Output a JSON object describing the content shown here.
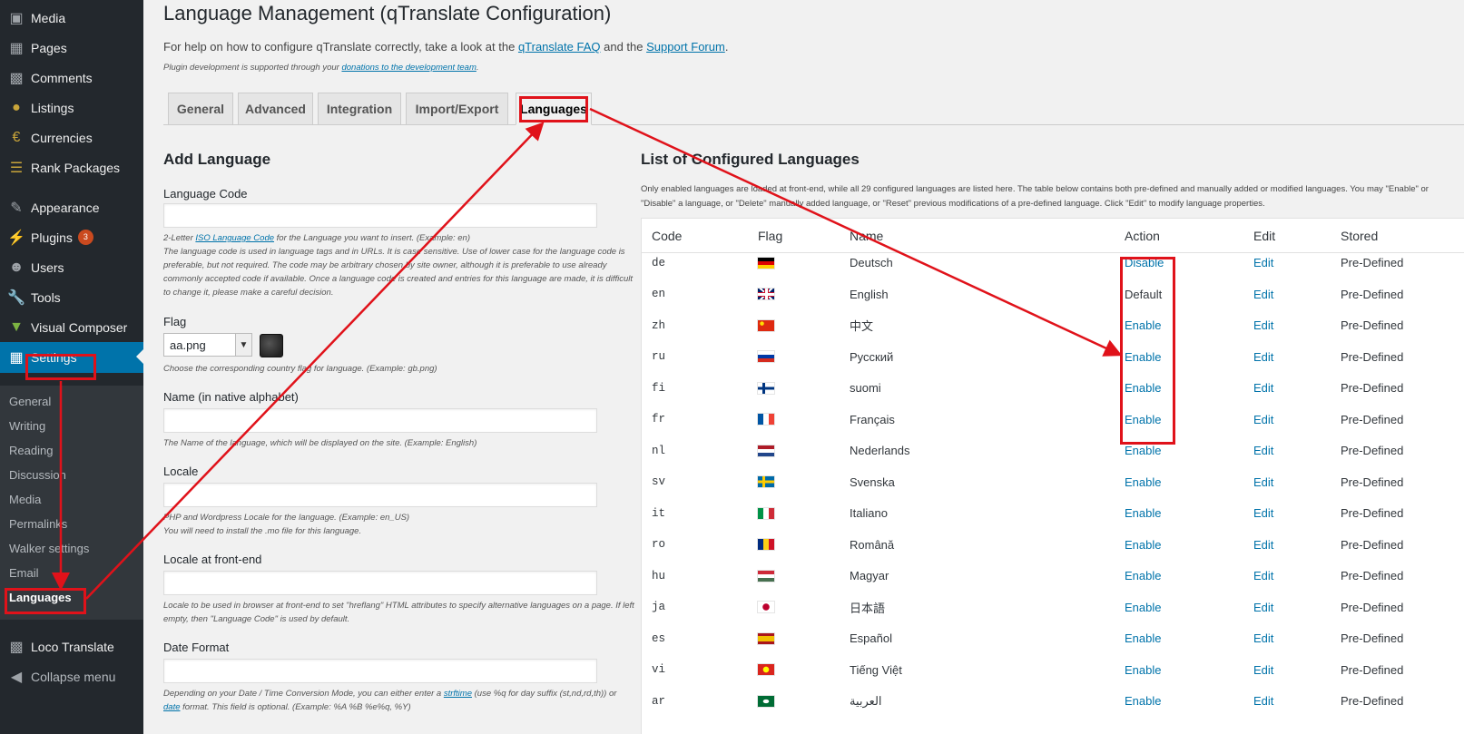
{
  "sidebar": {
    "items": [
      {
        "label": "Media",
        "icon": "media-icon"
      },
      {
        "label": "Pages",
        "icon": "pages-icon"
      },
      {
        "label": "Comments",
        "icon": "comments-icon"
      },
      {
        "label": "Listings",
        "icon": "pin-icon"
      },
      {
        "label": "Currencies",
        "icon": "euro-icon"
      },
      {
        "label": "Rank Packages",
        "icon": "layers-icon"
      },
      {
        "label": "Appearance",
        "icon": "brush-icon"
      },
      {
        "label": "Plugins",
        "icon": "plugin-icon",
        "badge": "3"
      },
      {
        "label": "Users",
        "icon": "user-icon"
      },
      {
        "label": "Tools",
        "icon": "wrench-icon"
      },
      {
        "label": "Visual Composer",
        "icon": "vc-icon"
      },
      {
        "label": "Settings",
        "icon": "settings-icon"
      },
      {
        "label": "Loco Translate",
        "icon": "translate-icon"
      },
      {
        "label": "Collapse menu",
        "icon": "collapse-icon"
      }
    ],
    "submenu": [
      "General",
      "Writing",
      "Reading",
      "Discussion",
      "Media",
      "Permalinks",
      "Walker settings",
      "Email",
      "Languages"
    ]
  },
  "page": {
    "title": "Language Management (qTranslate Configuration)",
    "help_prefix": "For help on how to configure qTranslate correctly, take a look at the ",
    "faq_link": "qTranslate FAQ",
    "help_and": " and the ",
    "forum_link": "Support Forum",
    "help_end": ".",
    "plugin_note_prefix": "Plugin development is supported through your ",
    "plugin_note_link": "donations to the development team",
    "plugin_note_end": "."
  },
  "tabs": [
    "General",
    "Advanced",
    "Integration",
    "Import/Export",
    "Languages"
  ],
  "add_language": {
    "title": "Add Language",
    "code_label": "Language Code",
    "code_note_1a": "2-Letter ",
    "code_note_link": "ISO Language Code",
    "code_note_1b": " for the Language you want to insert. (Example: en)",
    "code_note_2": "The language code is used in language tags and in URLs. It is case sensitive. Use of lower case for the language code is preferable, but not required. The code may be arbitrary chosen by site owner, although it is preferable to use already commonly accepted code if available. Once a language code is created and entries for this language are made, it is difficult to change it, please make a careful decision.",
    "flag_label": "Flag",
    "flag_value": "aa.png",
    "flag_note": "Choose the corresponding country flag for language. (Example: gb.png)",
    "name_label": "Name (in native alphabet)",
    "name_note": "The Name of the language, which will be displayed on the site. (Example: English)",
    "locale_label": "Locale",
    "locale_note_1": "PHP and Wordpress Locale for the language. (Example: en_US)",
    "locale_note_2": "You will need to install the .mo file for this language.",
    "locale_fe_label": "Locale at front-end",
    "locale_fe_note": "Locale to be used in browser at front-end to set \"hreflang\" HTML attributes to specify alternative languages on a page. If left empty, then \"Language Code\" is used by default.",
    "date_label": "Date Format",
    "date_note_a": "Depending on your Date / Time Conversion Mode, you can either enter a ",
    "date_note_link1": "strftime",
    "date_note_b": " (use %q for day suffix (st,nd,rd,th)) or ",
    "date_note_link2": "date",
    "date_note_c": " format. This field is optional. (Example: %A %B %e%q, %Y)"
  },
  "list": {
    "title": "List of Configured Languages",
    "description": "Only enabled languages are loaded at front-end, while all 29 configured languages are listed here. The table below contains both pre-defined and manually added or modified languages. You may \"Enable\" or \"Disable\" a language, or \"Delete\" manually added language, or \"Reset\" previous modifications of a pre-defined language. Click \"Edit\" to modify language properties.",
    "headers": {
      "code": "Code",
      "flag": "Flag",
      "name": "Name",
      "action": "Action",
      "edit": "Edit",
      "stored": "Stored"
    },
    "rows": [
      {
        "code": "de",
        "flag": "de",
        "name": "Deutsch",
        "action": "Disable",
        "action_link": true,
        "edit": "Edit",
        "stored": "Pre-Defined"
      },
      {
        "code": "en",
        "flag": "gb",
        "name": "English",
        "action": "Default",
        "action_link": false,
        "edit": "Edit",
        "stored": "Pre-Defined"
      },
      {
        "code": "zh",
        "flag": "cn",
        "name": "中文",
        "action": "Enable",
        "action_link": true,
        "edit": "Edit",
        "stored": "Pre-Defined"
      },
      {
        "code": "ru",
        "flag": "ru",
        "name": "Русский",
        "action": "Enable",
        "action_link": true,
        "edit": "Edit",
        "stored": "Pre-Defined"
      },
      {
        "code": "fi",
        "flag": "fi",
        "name": "suomi",
        "action": "Enable",
        "action_link": true,
        "edit": "Edit",
        "stored": "Pre-Defined"
      },
      {
        "code": "fr",
        "flag": "fr",
        "name": "Français",
        "action": "Enable",
        "action_link": true,
        "edit": "Edit",
        "stored": "Pre-Defined"
      },
      {
        "code": "nl",
        "flag": "nl",
        "name": "Nederlands",
        "action": "Enable",
        "action_link": true,
        "edit": "Edit",
        "stored": "Pre-Defined"
      },
      {
        "code": "sv",
        "flag": "se",
        "name": "Svenska",
        "action": "Enable",
        "action_link": true,
        "edit": "Edit",
        "stored": "Pre-Defined"
      },
      {
        "code": "it",
        "flag": "it",
        "name": "Italiano",
        "action": "Enable",
        "action_link": true,
        "edit": "Edit",
        "stored": "Pre-Defined"
      },
      {
        "code": "ro",
        "flag": "ro",
        "name": "Română",
        "action": "Enable",
        "action_link": true,
        "edit": "Edit",
        "stored": "Pre-Defined"
      },
      {
        "code": "hu",
        "flag": "hu",
        "name": "Magyar",
        "action": "Enable",
        "action_link": true,
        "edit": "Edit",
        "stored": "Pre-Defined"
      },
      {
        "code": "ja",
        "flag": "jp",
        "name": "日本語",
        "action": "Enable",
        "action_link": true,
        "edit": "Edit",
        "stored": "Pre-Defined"
      },
      {
        "code": "es",
        "flag": "es",
        "name": "Español",
        "action": "Enable",
        "action_link": true,
        "edit": "Edit",
        "stored": "Pre-Defined"
      },
      {
        "code": "vi",
        "flag": "vn",
        "name": "Tiếng Việt",
        "action": "Enable",
        "action_link": true,
        "edit": "Edit",
        "stored": "Pre-Defined"
      },
      {
        "code": "ar",
        "flag": "sa",
        "name": "العربية",
        "action": "Enable",
        "action_link": true,
        "edit": "Edit",
        "stored": "Pre-Defined"
      }
    ]
  },
  "colors": {
    "sidebar_bg": "#23282d",
    "submenu_bg": "#32373c",
    "accent": "#0073aa",
    "annotation_red": "#e0121a",
    "badge": "#ca4a1f"
  }
}
